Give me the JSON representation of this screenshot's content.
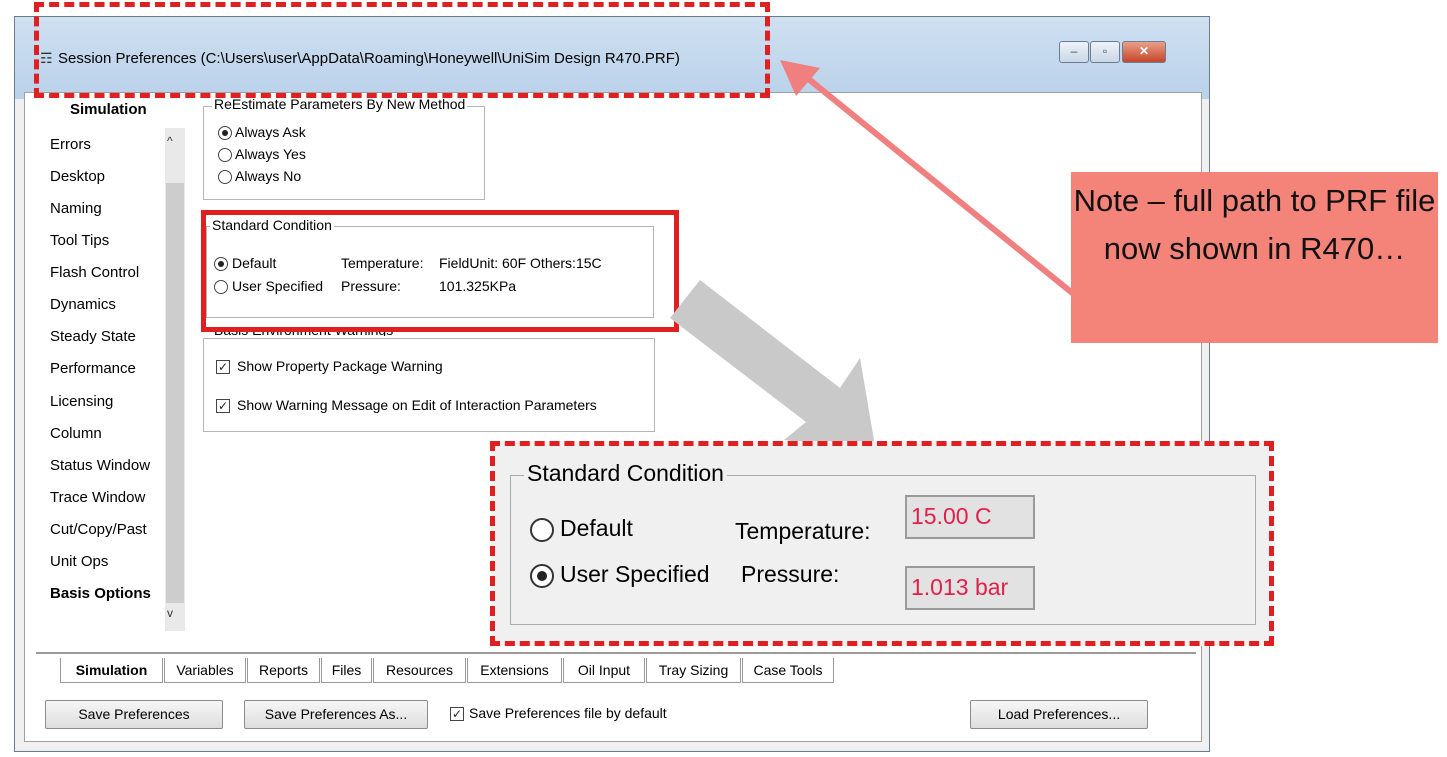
{
  "window": {
    "title": "Session Preferences (C:\\Users\\user\\AppData\\Roaming\\Honeywell\\UniSim Design R470.PRF)",
    "controls": {
      "minimize": "‒",
      "maximize": "▫",
      "close": "✕"
    }
  },
  "sidebar": {
    "heading": "Simulation",
    "items": [
      {
        "label": "Errors"
      },
      {
        "label": "Desktop"
      },
      {
        "label": "Naming"
      },
      {
        "label": "Tool Tips"
      },
      {
        "label": "Flash Control"
      },
      {
        "label": "Dynamics"
      },
      {
        "label": "Steady State"
      },
      {
        "label": "Performance"
      },
      {
        "label": "Licensing"
      },
      {
        "label": "Column"
      },
      {
        "label": "Status Window"
      },
      {
        "label": "Trace Window"
      },
      {
        "label": "Cut/Copy/Past"
      },
      {
        "label": "Unit Ops"
      },
      {
        "label": "Basis Options"
      }
    ],
    "scroll_up": "^",
    "scroll_down": "v"
  },
  "reestimate": {
    "title": "ReEstimate Parameters By New Method",
    "options": [
      "Always Ask",
      "Always Yes",
      "Always No"
    ],
    "selected": "Always Ask"
  },
  "standard_condition": {
    "title": "Standard Condition",
    "options": [
      "Default",
      "User Specified"
    ],
    "selected": "Default",
    "temperature_label": "Temperature:",
    "temperature_value": "FieldUnit: 60F Others:15C",
    "pressure_label": "Pressure:",
    "pressure_value": "101.325KPa"
  },
  "basis_warnings": {
    "title": "Basis Environment Warnings",
    "checks": [
      {
        "label": "Show Property Package Warning",
        "checked": true
      },
      {
        "label": "Show Warning Message on Edit of Interaction Parameters",
        "checked": true
      }
    ]
  },
  "tabs": [
    "Simulation",
    "Variables",
    "Reports",
    "Files",
    "Resources",
    "Extensions",
    "Oil Input",
    "Tray Sizing",
    "Case Tools"
  ],
  "active_tab": "Simulation",
  "footer": {
    "save": "Save Preferences",
    "save_as": "Save Preferences As...",
    "save_default_label": "Save Preferences file by default",
    "save_default_checked": true,
    "load": "Load Preferences..."
  },
  "annotation": {
    "note": "Note – full path to PRF file now shown in R470…",
    "zoom": {
      "title": "Standard Condition",
      "options": [
        "Default",
        "User Specified"
      ],
      "selected": "User Specified",
      "temperature_label": "Temperature:",
      "temperature_value": "15.00 C",
      "pressure_label": "Pressure:",
      "pressure_value": "1.013 bar"
    }
  },
  "colors": {
    "annotation_red": "#e02020",
    "note_fill": "#f4837a",
    "value_red": "#e0204a"
  }
}
